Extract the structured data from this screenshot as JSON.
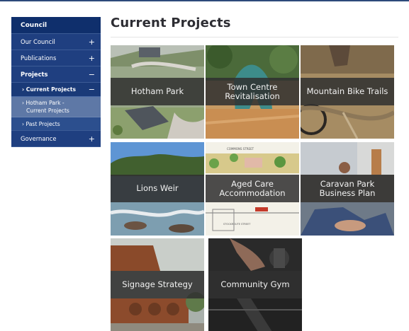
{
  "sidebar": {
    "header": "Council",
    "items": [
      {
        "label": "Our Council",
        "sign": "+"
      },
      {
        "label": "Publications",
        "sign": "+"
      },
      {
        "label": "Projects",
        "sign": "−"
      }
    ],
    "sub_current": {
      "label": "Current Projects",
      "sign": "−"
    },
    "sub_hotham": {
      "line1": "Hotham Park -",
      "line2": "Current Projects"
    },
    "sub_past": {
      "label": "Past Projects"
    },
    "governance": {
      "label": "Governance",
      "sign": "+"
    }
  },
  "main": {
    "title": "Current Projects",
    "tiles": [
      {
        "label": "Hotham Park"
      },
      {
        "label": "Town Centre Revitalisation"
      },
      {
        "label": "Mountain Bike Trails"
      },
      {
        "label": "Lions Weir"
      },
      {
        "label": "Aged Care Accommodation"
      },
      {
        "label": "Caravan Park Business Plan"
      },
      {
        "label": "Signage Strategy"
      },
      {
        "label": "Community Gym"
      }
    ],
    "plan_street_top": "COMMONS STREET",
    "plan_street_bottom": "STOCKROUTE STREET"
  },
  "colors": {
    "sidebar_bg": "#1f3f80",
    "sidebar_header": "#0f2f6c",
    "sidebar_highlight": "#5e78a6",
    "tile_band": "#303030",
    "title": "#2d2d33"
  }
}
